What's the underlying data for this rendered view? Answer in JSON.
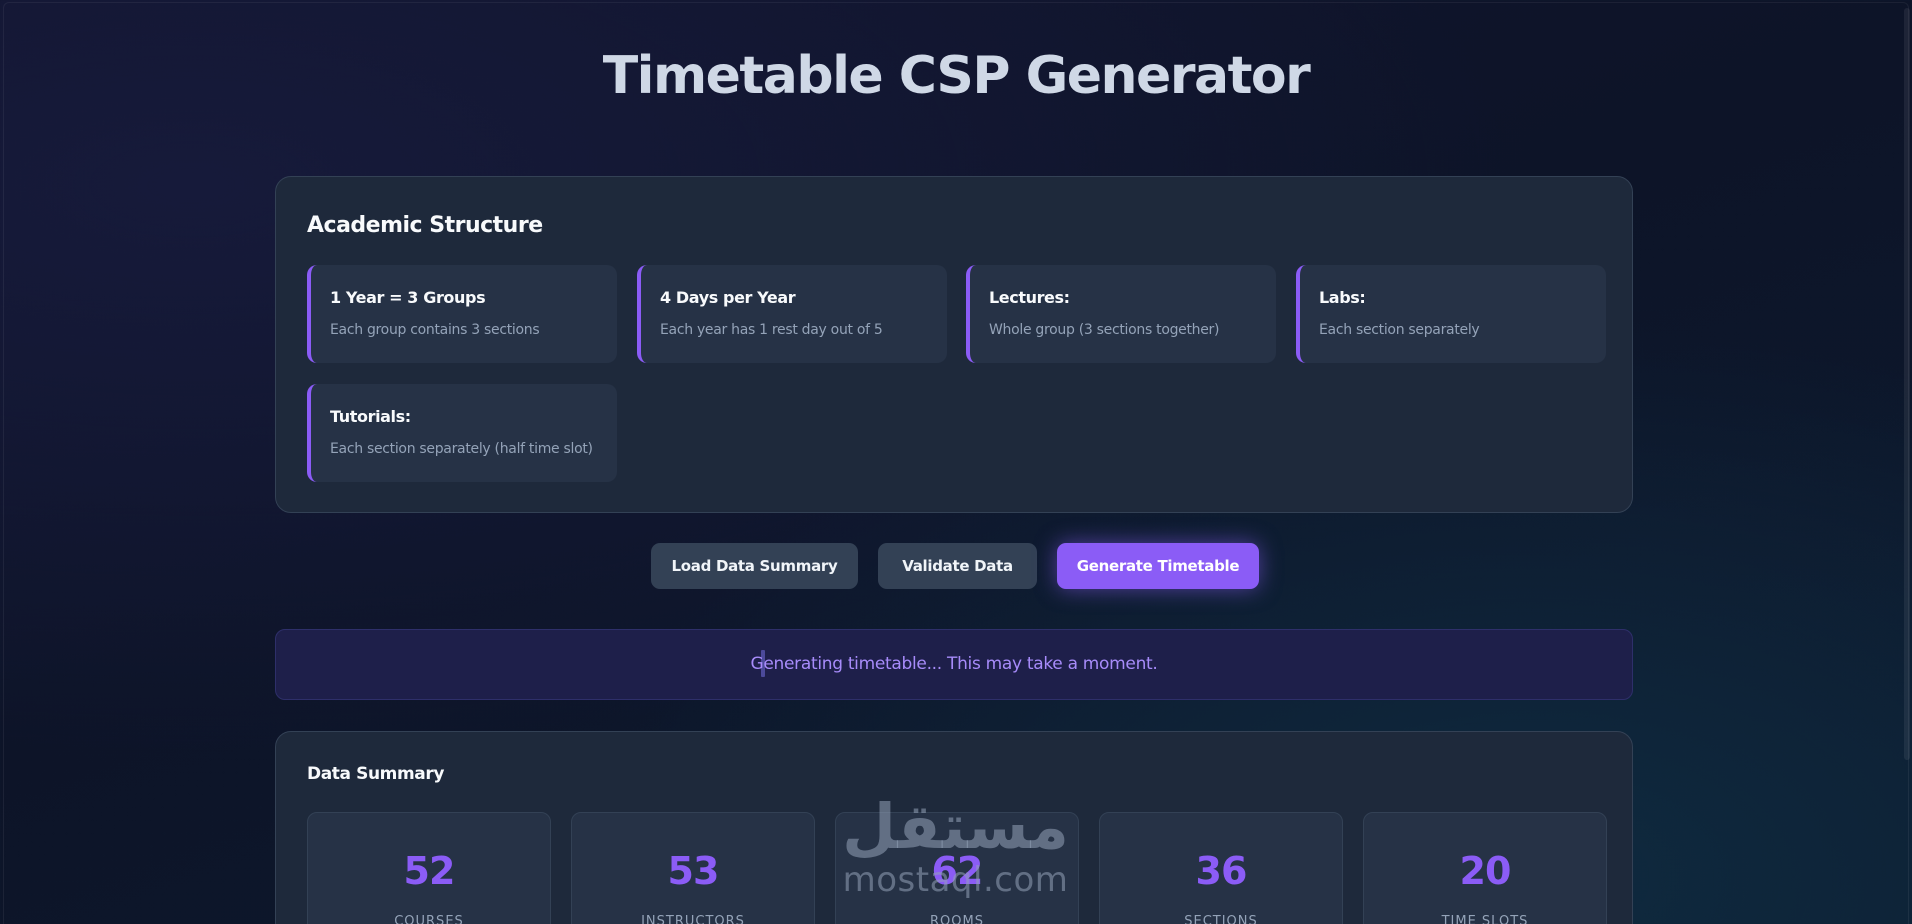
{
  "page": {
    "title": "Timetable CSP Generator"
  },
  "theme": {
    "accent": "#8b5cf6",
    "panel": "#1e293b",
    "card": "#263246",
    "status_text": "#a78bfa"
  },
  "structure": {
    "title": "Academic Structure",
    "cards": [
      {
        "title": "1 Year = 3 Groups",
        "desc": "Each group contains 3 sections"
      },
      {
        "title": "4 Days per Year",
        "desc": "Each year has 1 rest day out of 5"
      },
      {
        "title": "Lectures:",
        "desc": "Whole group (3 sections together)"
      },
      {
        "title": "Labs:",
        "desc": "Each section separately"
      },
      {
        "title": "Tutorials:",
        "desc": "Each section separately (half time slot)"
      }
    ]
  },
  "actions": {
    "load_summary": "Load Data Summary",
    "validate": "Validate Data",
    "generate": "Generate Timetable"
  },
  "status": {
    "message": "Generating timetable... This may take a moment."
  },
  "summary": {
    "title": "Data Summary",
    "stats": [
      {
        "value": "52",
        "label": "COURSES"
      },
      {
        "value": "53",
        "label": "INSTRUCTORS"
      },
      {
        "value": "62",
        "label": "ROOMS"
      },
      {
        "value": "36",
        "label": "SECTIONS"
      },
      {
        "value": "20",
        "label": "TIME SLOTS"
      }
    ]
  },
  "watermark": {
    "arabic": "مستقل",
    "latin": "mostaql.com"
  }
}
